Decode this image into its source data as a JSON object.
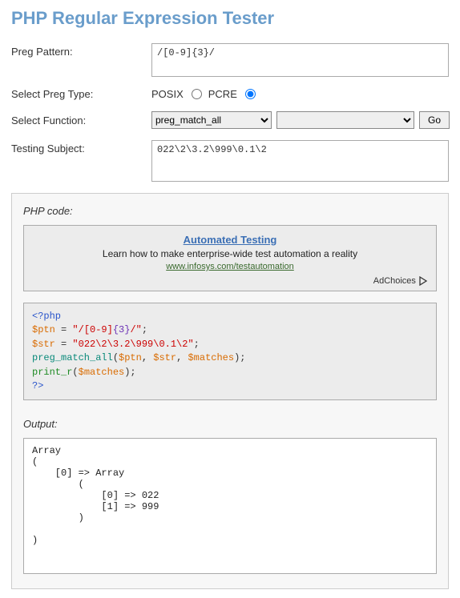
{
  "title": "PHP Regular Expression Tester",
  "form": {
    "pattern_label": "Preg Pattern:",
    "pattern_value": "/[0-9]{3}/",
    "type_label": "Select Preg Type:",
    "posix_label": "POSIX",
    "pcre_label": "PCRE",
    "function_label": "Select Function:",
    "function_selected": "preg_match_all",
    "go_label": "Go",
    "subject_label": "Testing Subject:",
    "subject_value": "022\\2\\3.2\\999\\0.1\\2"
  },
  "phpcode_title": "PHP code:",
  "ad": {
    "title": "Automated Testing",
    "desc": "Learn how to make enterprise-wide test automation a reality",
    "url": "www.infosys.com/testautomation",
    "choices": "AdChoices"
  },
  "code": {
    "open_tag": "<?php",
    "l2_a": "$ptn",
    "l2_b": " = ",
    "l2_c": "\"/[0-9]",
    "l2_d": "{3}",
    "l2_e": "/\"",
    "l2_f": ";",
    "l3_a": "$str",
    "l3_b": " = ",
    "l3_c": "\"022\\2\\3.2\\999\\0.1\\2\"",
    "l3_d": ";",
    "l4_a": "preg_match_all",
    "l4_b": "(",
    "l4_c": "$ptn",
    "l4_d": ", ",
    "l4_e": "$str",
    "l4_f": ", ",
    "l4_g": "$matches",
    "l4_h": ");",
    "l5_a": "print_r",
    "l5_b": "(",
    "l5_c": "$matches",
    "l5_d": ");",
    "close_tag": "?>"
  },
  "output_title": "Output:",
  "output_text": "Array\n(\n    [0] => Array\n        (\n            [0] => 022\n            [1] => 999\n        )\n\n)"
}
